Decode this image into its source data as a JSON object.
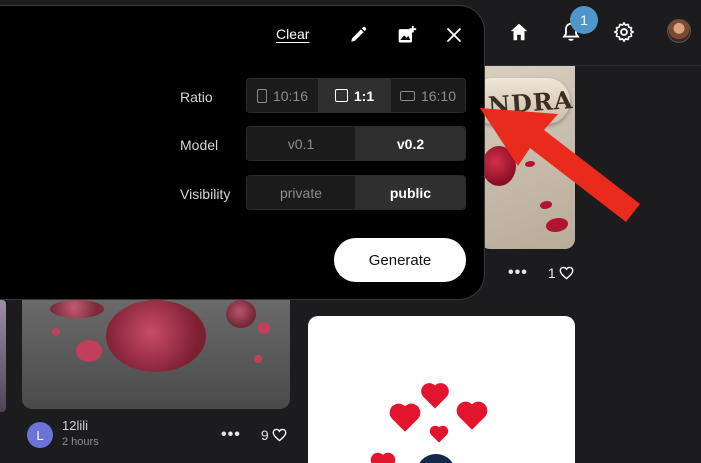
{
  "nav": {
    "notification_count": "1",
    "icons": [
      "home-icon",
      "bell-icon",
      "gear-icon",
      "avatar"
    ]
  },
  "modal": {
    "clear_label": "Clear",
    "icons": [
      "pencil-icon",
      "image-add-icon",
      "close-icon"
    ],
    "ratio": {
      "label": "Ratio",
      "options": [
        "10:16",
        "1:1",
        "16:10"
      ],
      "selected": "1:1"
    },
    "model": {
      "label": "Model",
      "options": [
        "v0.1",
        "v0.2"
      ],
      "selected": "v0.2"
    },
    "visibility": {
      "label": "Visibility",
      "options": [
        "private",
        "public"
      ],
      "selected": "public"
    },
    "generate_label": "Generate"
  },
  "cards": {
    "top_right": {
      "likes": "1",
      "scroll_text": "NDRA"
    },
    "left_bottom": {
      "likes": "9",
      "user_initial": "L",
      "username": "12lili",
      "time": "2 hours"
    }
  },
  "colors": {
    "accent_badge": "#4f97c9",
    "arrow": "#e82b1d",
    "avatar_bg": "#6a74d8"
  }
}
